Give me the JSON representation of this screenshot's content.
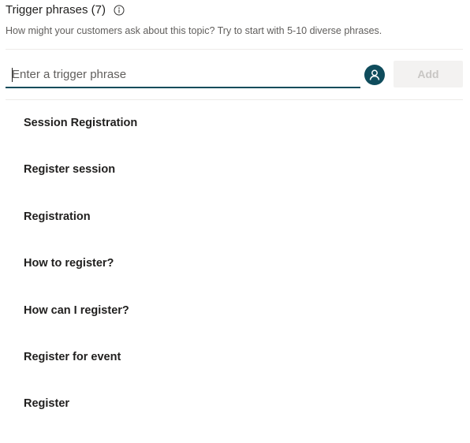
{
  "header": {
    "title": "Trigger phrases (7)",
    "subtitle": "How might your customers ask about this topic? Try to start with 5-10 diverse phrases."
  },
  "input": {
    "placeholder": "Enter a trigger phrase",
    "value": ""
  },
  "add_button": {
    "label": "Add"
  },
  "colors": {
    "accent": "#0f4c5c",
    "disabled_bg": "#f3f2f1",
    "disabled_text": "#c8c6c4"
  },
  "icons": {
    "info": "info-icon",
    "avatar": "person-icon"
  },
  "phrases": [
    "Session Registration",
    "Register session",
    "Registration",
    "How to register?",
    "How can I register?",
    "Register for event",
    "Register"
  ]
}
